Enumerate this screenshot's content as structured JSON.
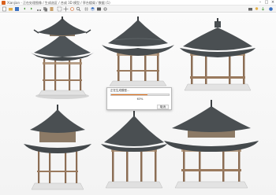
{
  "window": {
    "title": "Xianjian - 正在处理图像 / 生成选区 / 合成 3D 模型 / 亭台楼阁 / 数据 (1)",
    "icon": "app-logo-icon",
    "controls": [
      "minimize-icon",
      "maximize-icon",
      "close-icon"
    ]
  },
  "toolbar": {
    "icons": [
      "new-file-icon",
      "open-folder-icon",
      "save-icon",
      "undo-icon",
      "redo-icon",
      "cut-icon",
      "copy-icon",
      "paste-icon",
      "select-icon",
      "move-icon",
      "rotate-icon",
      "zoom-icon",
      "grid-icon",
      "layers-icon",
      "render-icon",
      "settings-icon"
    ],
    "right_icons": [
      "camera-icon",
      "light-icon",
      "export-icon",
      "help-icon"
    ]
  },
  "dialog": {
    "message": "正在生成模型…",
    "progress_label": "63%",
    "progress_fraction": 0.63,
    "cancel_label": "取消",
    "accent_color": "#e8761e"
  },
  "canvas": {
    "background": "#f5f5f5",
    "roof_color": "#4a4f52",
    "wood_color": "#9a7a5e",
    "base_color": "#dcdcdc"
  }
}
